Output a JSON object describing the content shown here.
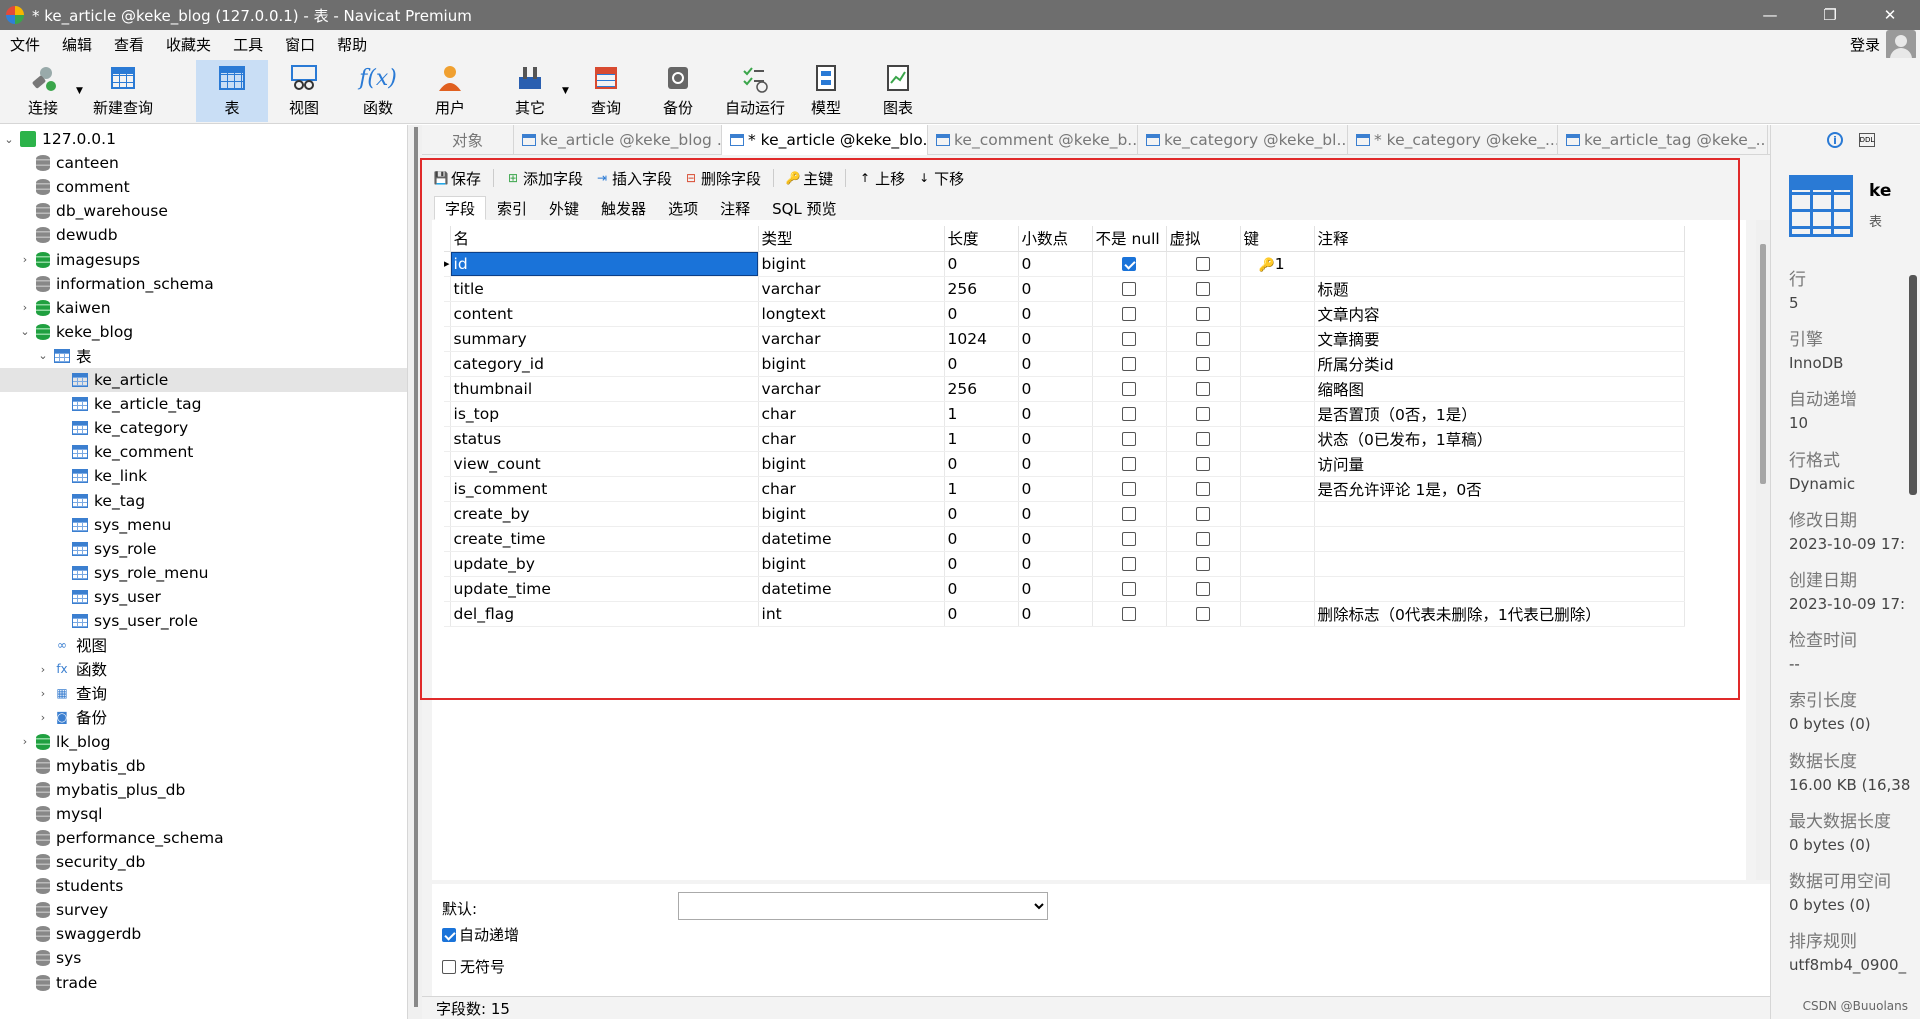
{
  "window": {
    "title": "* ke_article @keke_blog (127.0.0.1) - 表 - Navicat Premium",
    "min": "—",
    "max": "❐",
    "close": "✕"
  },
  "menu": {
    "items": [
      "文件",
      "编辑",
      "查看",
      "收藏夹",
      "工具",
      "窗口",
      "帮助"
    ],
    "login": "登录"
  },
  "toolbar": {
    "connect": "连接",
    "new_query": "新建查询",
    "table": "表",
    "view": "视图",
    "function": "函数",
    "user": "用户",
    "other": "其它",
    "query": "查询",
    "backup": "备份",
    "auto_run": "自动运行",
    "model": "模型",
    "chart": "图表"
  },
  "tree": {
    "root": "127.0.0.1",
    "dbs_top": [
      "canteen",
      "comment",
      "db_warehouse",
      "dewudb",
      "imagesups",
      "information_schema",
      "kaiwen",
      "keke_blog"
    ],
    "tables_label": "表",
    "tables": [
      "ke_article",
      "ke_article_tag",
      "ke_category",
      "ke_comment",
      "ke_link",
      "ke_tag",
      "sys_menu",
      "sys_role",
      "sys_role_menu",
      "sys_user",
      "sys_user_role"
    ],
    "views_label": "视图",
    "functions_label": "函数",
    "queries_label": "查询",
    "backups_label": "备份",
    "dbs_bottom": [
      "lk_blog",
      "mybatis_db",
      "mybatis_plus_db",
      "mysql",
      "performance_schema",
      "security_db",
      "students",
      "survey",
      "swaggerdb",
      "sys",
      "trade"
    ]
  },
  "tabs": {
    "object": "对象",
    "items": [
      "ke_article @keke_blog ...",
      "* ke_article @keke_blo...",
      "ke_comment @keke_b...",
      "ke_category @keke_bl...",
      "* ke_category @keke_...",
      "ke_article_tag @keke_..."
    ]
  },
  "designer": {
    "toolbar": {
      "save": "保存",
      "add_field": "添加字段",
      "insert_field": "插入字段",
      "delete_field": "删除字段",
      "primary_key": "主键",
      "move_up": "上移",
      "move_down": "下移"
    },
    "subtabs": [
      "字段",
      "索引",
      "外键",
      "触发器",
      "选项",
      "注释",
      "SQL 预览"
    ],
    "columns": [
      "名",
      "类型",
      "长度",
      "小数点",
      "不是 null",
      "虚拟",
      "键",
      "注释"
    ],
    "rows": [
      {
        "name": "id",
        "type": "bigint",
        "len": "0",
        "dec": "0",
        "notnull": true,
        "virtual": false,
        "key": "1",
        "comment": ""
      },
      {
        "name": "title",
        "type": "varchar",
        "len": "256",
        "dec": "0",
        "notnull": false,
        "virtual": false,
        "key": "",
        "comment": "标题"
      },
      {
        "name": "content",
        "type": "longtext",
        "len": "0",
        "dec": "0",
        "notnull": false,
        "virtual": false,
        "key": "",
        "comment": "文章内容"
      },
      {
        "name": "summary",
        "type": "varchar",
        "len": "1024",
        "dec": "0",
        "notnull": false,
        "virtual": false,
        "key": "",
        "comment": "文章摘要"
      },
      {
        "name": "category_id",
        "type": "bigint",
        "len": "0",
        "dec": "0",
        "notnull": false,
        "virtual": false,
        "key": "",
        "comment": "所属分类id"
      },
      {
        "name": "thumbnail",
        "type": "varchar",
        "len": "256",
        "dec": "0",
        "notnull": false,
        "virtual": false,
        "key": "",
        "comment": "缩略图"
      },
      {
        "name": "is_top",
        "type": "char",
        "len": "1",
        "dec": "0",
        "notnull": false,
        "virtual": false,
        "key": "",
        "comment": "是否置顶（0否，1是）"
      },
      {
        "name": "status",
        "type": "char",
        "len": "1",
        "dec": "0",
        "notnull": false,
        "virtual": false,
        "key": "",
        "comment": "状态（0已发布，1草稿）"
      },
      {
        "name": "view_count",
        "type": "bigint",
        "len": "0",
        "dec": "0",
        "notnull": false,
        "virtual": false,
        "key": "",
        "comment": "访问量"
      },
      {
        "name": "is_comment",
        "type": "char",
        "len": "1",
        "dec": "0",
        "notnull": false,
        "virtual": false,
        "key": "",
        "comment": "是否允许评论 1是，0否"
      },
      {
        "name": "create_by",
        "type": "bigint",
        "len": "0",
        "dec": "0",
        "notnull": false,
        "virtual": false,
        "key": "",
        "comment": ""
      },
      {
        "name": "create_time",
        "type": "datetime",
        "len": "0",
        "dec": "0",
        "notnull": false,
        "virtual": false,
        "key": "",
        "comment": ""
      },
      {
        "name": "update_by",
        "type": "bigint",
        "len": "0",
        "dec": "0",
        "notnull": false,
        "virtual": false,
        "key": "",
        "comment": ""
      },
      {
        "name": "update_time",
        "type": "datetime",
        "len": "0",
        "dec": "0",
        "notnull": false,
        "virtual": false,
        "key": "",
        "comment": ""
      },
      {
        "name": "del_flag",
        "type": "int",
        "len": "0",
        "dec": "0",
        "notnull": false,
        "virtual": false,
        "key": "",
        "comment": "删除标志（0代表未删除，1代表已删除）"
      }
    ],
    "props": {
      "default_label": "默认:",
      "auto_increment": "自动递增",
      "unsigned": "无符号",
      "auto_increment_checked": true,
      "unsigned_checked": false
    },
    "status": "字段数: 15"
  },
  "info": {
    "name": "ke",
    "kind": "表",
    "items": [
      {
        "label": "行",
        "value": "5"
      },
      {
        "label": "引擎",
        "value": "InnoDB"
      },
      {
        "label": "自动递增",
        "value": "10"
      },
      {
        "label": "行格式",
        "value": "Dynamic"
      },
      {
        "label": "修改日期",
        "value": "2023-10-09 17:"
      },
      {
        "label": "创建日期",
        "value": "2023-10-09 17:"
      },
      {
        "label": "检查时间",
        "value": "--"
      },
      {
        "label": "索引长度",
        "value": "0 bytes (0)"
      },
      {
        "label": "数据长度",
        "value": "16.00 KB (16,38"
      },
      {
        "label": "最大数据长度",
        "value": "0 bytes (0)"
      },
      {
        "label": "数据可用空间",
        "value": "0 bytes (0)"
      },
      {
        "label": "排序规则",
        "value": "utf8mb4_0900_"
      }
    ],
    "watermark": "CSDN @Buuolans"
  },
  "colors": {
    "accent": "#1a73d9",
    "highlight_box": "#e02a2a",
    "selected_tree": "#e4e4e4"
  }
}
